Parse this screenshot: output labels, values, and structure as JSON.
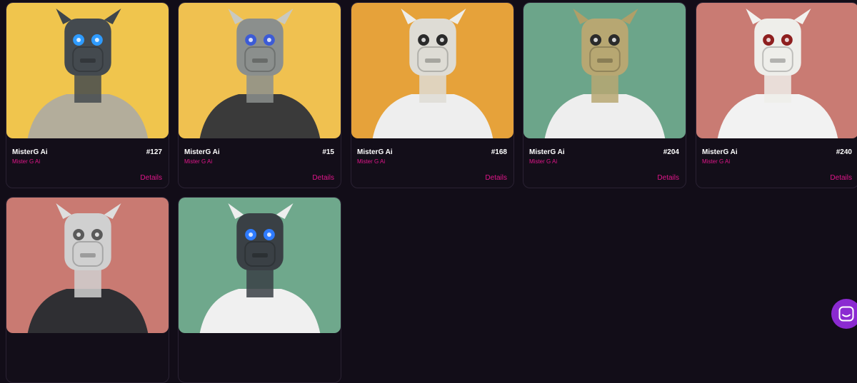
{
  "cards": [
    {
      "name": "MisterG Ai",
      "number": "#127",
      "creator": "Mister G Ai",
      "details": "Details",
      "bg": "#f0c54d",
      "body": "#b3ad9b",
      "head": "#444a4f",
      "accent": "#2e9bff",
      "ears": "#3f464b",
      "image_icon": "robot-giraffe-portrait"
    },
    {
      "name": "MisterG Ai",
      "number": "#15",
      "creator": "Mister G Ai",
      "details": "Details",
      "bg": "#f0c150",
      "body": "#3a3a3a",
      "head": "#8b8f8d",
      "accent": "#3c5bd6",
      "ears": "#c9c9c0",
      "image_icon": "robot-giraffe-portrait"
    },
    {
      "name": "MisterG Ai",
      "number": "#168",
      "creator": "Mister G Ai",
      "details": "Details",
      "bg": "#e6a23a",
      "body": "#eeeeee",
      "head": "#dedcd5",
      "accent": "#2a2a2a",
      "ears": "#ededea",
      "image_icon": "robot-giraffe-portrait"
    },
    {
      "name": "MisterG Ai",
      "number": "#204",
      "creator": "Mister G Ai",
      "details": "Details",
      "bg": "#6ca58a",
      "body": "#eeeeee",
      "head": "#b7a772",
      "accent": "#2b2b2b",
      "ears": "#b09f68",
      "image_icon": "robot-giraffe-portrait"
    },
    {
      "name": "MisterG Ai",
      "number": "#240",
      "creator": "Mister G Ai",
      "details": "Details",
      "bg": "#c97b73",
      "body": "#f2f2f2",
      "head": "#eeeeea",
      "accent": "#8e1f1f",
      "ears": "#f2f2ef",
      "image_icon": "robot-giraffe-portrait"
    },
    {
      "name": "",
      "number": "",
      "creator": "",
      "details": "",
      "bg": "#c97a72",
      "body": "#2f2f33",
      "head": "#d0d0d0",
      "accent": "#5a5a5a",
      "ears": "#dedede",
      "image_icon": "robot-giraffe-portrait"
    },
    {
      "name": "",
      "number": "",
      "creator": "",
      "details": "",
      "bg": "#6fa88c",
      "body": "#f0f0f0",
      "head": "#3a4045",
      "accent": "#2e7bff",
      "ears": "#eeeeee",
      "image_icon": "robot-giraffe-portrait"
    }
  ],
  "chat_widget": {
    "icon": "chat-bubble-icon",
    "color": "#8b2ad1"
  }
}
